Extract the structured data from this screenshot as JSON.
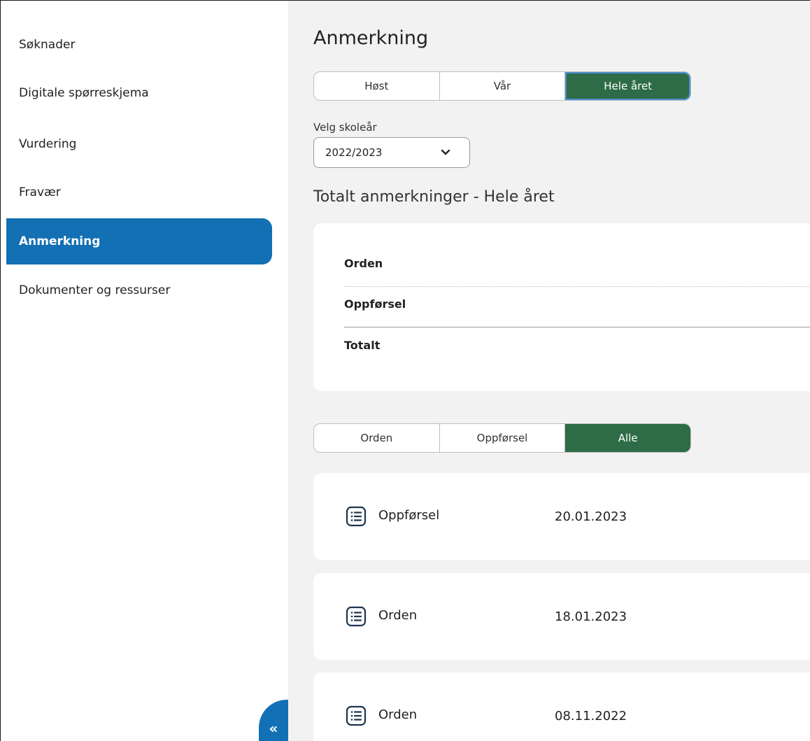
{
  "sidebar": {
    "items": [
      {
        "label": "Søknader",
        "active": false
      },
      {
        "label": "Digitale spørreskjema",
        "active": false
      },
      {
        "label": "Vurdering",
        "active": false
      },
      {
        "label": "Fravær",
        "active": false
      },
      {
        "label": "Anmerkning",
        "active": true
      },
      {
        "label": "Dokumenter og ressurser",
        "active": false
      }
    ],
    "collapse_label": "«"
  },
  "main": {
    "title": "Anmerkning",
    "season_tabs": [
      {
        "label": "Høst",
        "selected": false
      },
      {
        "label": "Vår",
        "selected": false
      },
      {
        "label": "Hele året",
        "selected": true
      }
    ],
    "year_select": {
      "label": "Velg skoleår",
      "value": "2022/2023"
    },
    "summary_title": "Totalt anmerkninger - Hele året",
    "summary_rows": [
      {
        "label": "Orden"
      },
      {
        "label": "Oppførsel"
      },
      {
        "label": "Totalt"
      }
    ],
    "filter_tabs": [
      {
        "label": "Orden",
        "selected": false
      },
      {
        "label": "Oppførsel",
        "selected": false
      },
      {
        "label": "Alle",
        "selected": true
      }
    ],
    "entries": [
      {
        "type": "Oppførsel",
        "date": "20.01.2023",
        "icon": "list-icon"
      },
      {
        "type": "Orden",
        "date": "18.01.2023",
        "icon": "list-icon"
      },
      {
        "type": "Orden",
        "date": "08.11.2022",
        "icon": "list-icon"
      }
    ]
  },
  "colors": {
    "accent_blue": "#1370b4",
    "selected_green": "#2e6c47",
    "main_bg": "#f2f2f2"
  }
}
